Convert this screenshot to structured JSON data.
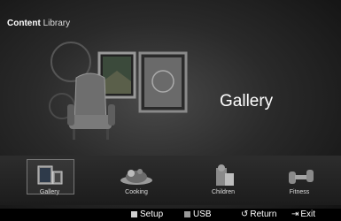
{
  "header": {
    "title_bold": "Content",
    "title_rest": "Library"
  },
  "hero": {
    "title": "Gallery"
  },
  "categories": [
    {
      "label": "Gallery",
      "icon": "gallery-icon",
      "selected": true
    },
    {
      "label": "Cooking",
      "icon": "cooking-icon",
      "selected": false
    },
    {
      "label": "Children",
      "icon": "children-icon",
      "selected": false
    },
    {
      "label": "Fitness",
      "icon": "fitness-icon",
      "selected": false
    }
  ],
  "footer": {
    "setup_label": "Setup",
    "usb_label": "USB",
    "return_label": "Return",
    "exit_label": "Exit",
    "setup_color": "#cfcfcf",
    "usb_color": "#9a9a9a"
  }
}
